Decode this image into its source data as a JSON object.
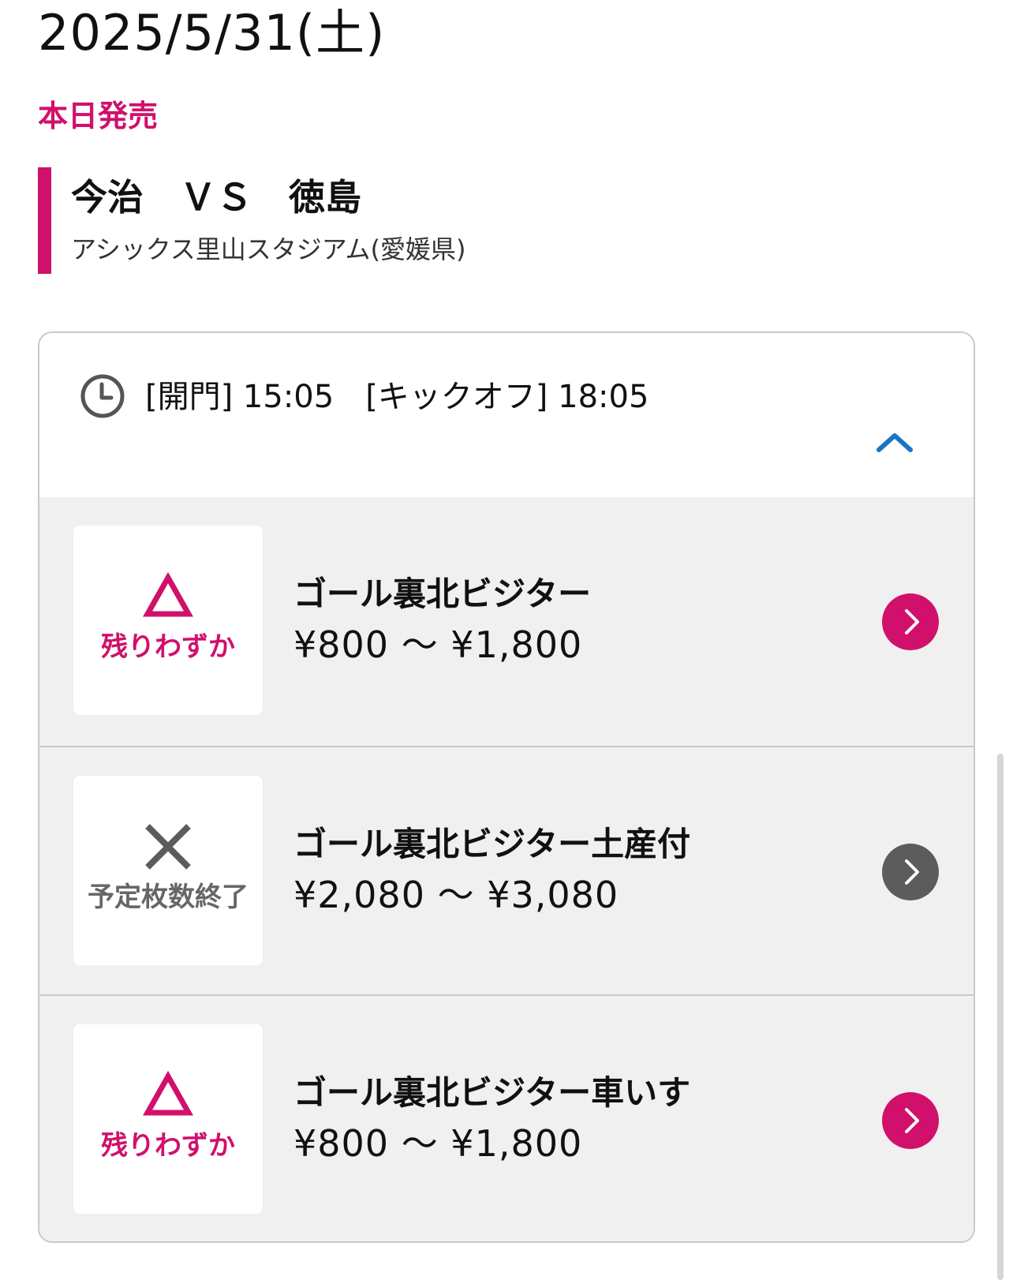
{
  "event": {
    "date": "2025/5/31(土)",
    "sale_status": "本日発売",
    "match_title": "今治　ＶＳ　徳島",
    "venue": "アシックス里山スタジアム(愛媛県)"
  },
  "schedule": {
    "time_text": "[開門] 15:05　[キックオフ] 18:05",
    "clock_icon": "clock-icon",
    "collapse_icon": "chevron-up-icon"
  },
  "tickets": [
    {
      "name": "ゴール裏北ビジター",
      "price": "¥800 〜 ¥1,800",
      "status_label": "残りわずか",
      "status_icon": "triangle-icon",
      "status": "few"
    },
    {
      "name": "ゴール裏北ビジター土産付",
      "price": "¥2,080 〜 ¥3,080",
      "status_label": "予定枚数終了",
      "status_icon": "cross-icon",
      "status": "soldout"
    },
    {
      "name": "ゴール裏北ビジター車いす",
      "price": "¥800 〜 ¥1,800",
      "status_label": "残りわずか",
      "status_icon": "triangle-icon",
      "status": "few"
    }
  ],
  "colors": {
    "accent": "#d1106b",
    "link_blue": "#1a73c8",
    "soldout_gray": "#5c5c5c",
    "row_bg": "#f0f0f0",
    "border": "#c9c9c9"
  }
}
